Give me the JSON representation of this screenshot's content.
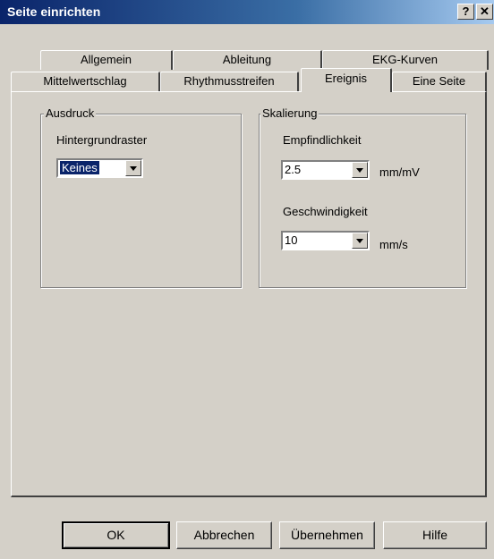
{
  "window": {
    "title": "Seite einrichten",
    "help_button": "?",
    "close_button": "✕"
  },
  "tabs": {
    "row1": [
      "Allgemein",
      "Ableitung",
      "EKG-Kurven"
    ],
    "row2": [
      "Mittelwertschlag",
      "Rhythmusstreifen",
      "Ereignis",
      "Eine Seite"
    ],
    "selected": "Ereignis"
  },
  "ausdruck": {
    "title": "Ausdruck",
    "grid_label": "Hintergrundraster",
    "grid_value": "Keines"
  },
  "skalierung": {
    "title": "Skalierung",
    "sensitivity_label": "Empfindlichkeit",
    "sensitivity_value": "2.5",
    "sensitivity_unit": "mm/mV",
    "speed_label": "Geschwindigkeit",
    "speed_value": "10",
    "speed_unit": "mm/s"
  },
  "buttons": {
    "ok": "OK",
    "cancel": "Abbrechen",
    "apply": "Übernehmen",
    "help": "Hilfe"
  }
}
